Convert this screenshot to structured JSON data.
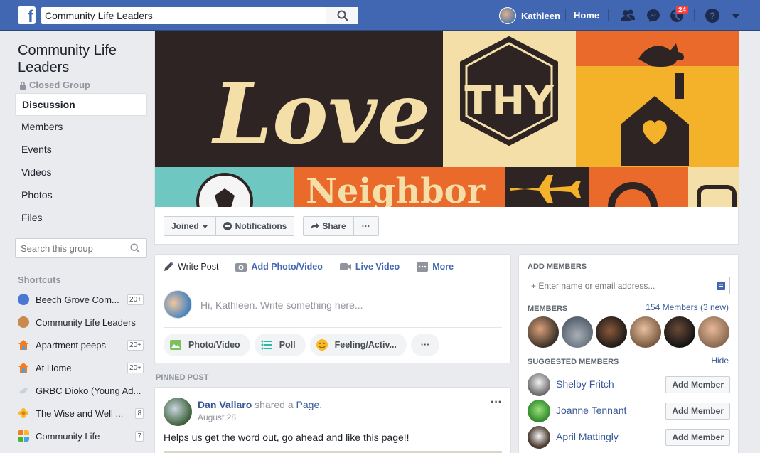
{
  "topbar": {
    "search_value": "Community Life Leaders",
    "profile_name": "Kathleen",
    "home_label": "Home",
    "notification_count": "24"
  },
  "group": {
    "title": "Community Life Leaders",
    "privacy": "Closed Group"
  },
  "leftnav": {
    "items": [
      {
        "label": "Discussion"
      },
      {
        "label": "Members"
      },
      {
        "label": "Events"
      },
      {
        "label": "Videos"
      },
      {
        "label": "Photos"
      },
      {
        "label": "Files"
      }
    ],
    "search_placeholder": "Search this group"
  },
  "shortcuts": {
    "heading": "Shortcuts",
    "items": [
      {
        "label": "Beech Grove Com...",
        "count": "20+",
        "icon": "group-icon"
      },
      {
        "label": "Community Life Leaders",
        "count": "",
        "icon": "group-avatar-icon"
      },
      {
        "label": "Apartment peeps",
        "count": "20+",
        "icon": "house-icon"
      },
      {
        "label": "At Home",
        "count": "20+",
        "icon": "house-icon"
      },
      {
        "label": "GRBC Diōkō (Young Ad...",
        "count": "",
        "icon": "dove-icon"
      },
      {
        "label": "The Wise and Well ...",
        "count": "8",
        "icon": "flower-icon"
      },
      {
        "label": "Community Life",
        "count": "7",
        "icon": "cross-icon"
      }
    ]
  },
  "cover": {
    "text_love": "Love",
    "text_thy": "THY",
    "text_neighbor": "Neighbor"
  },
  "cover_actions": {
    "joined": "Joined",
    "notifications": "Notifications",
    "share": "Share",
    "more": "···"
  },
  "composer": {
    "tabs": [
      {
        "label": "Write Post"
      },
      {
        "label": "Add Photo/Video"
      },
      {
        "label": "Live Video"
      },
      {
        "label": "More"
      }
    ],
    "placeholder": "Hi, Kathleen. Write something here...",
    "pills": [
      {
        "label": "Photo/Video"
      },
      {
        "label": "Poll"
      },
      {
        "label": "Feeling/Activ..."
      },
      {
        "label": "···"
      }
    ]
  },
  "pinned": {
    "heading": "PINNED POST",
    "author": "Dan Vallaro",
    "action": " shared a ",
    "object": "Page.",
    "date": "August 28",
    "body": "Helps us get the word out, go ahead and like this page!!",
    "more": "···"
  },
  "right": {
    "add_members_heading": "ADD MEMBERS",
    "add_members_placeholder": "+ Enter name or email address...",
    "members_heading": "MEMBERS",
    "members_link": "154 Members (3 new)",
    "suggested_heading": "SUGGESTED MEMBERS",
    "hide_label": "Hide",
    "suggested": [
      {
        "name": "Shelby Fritch",
        "button": "Add Member"
      },
      {
        "name": "Joanne Tennant",
        "button": "Add Member"
      },
      {
        "name": "April Mattingly",
        "button": "Add Member"
      }
    ]
  },
  "colors": {
    "brand": "#4267b2",
    "link": "#385898",
    "badge": "#fa3e3e"
  }
}
